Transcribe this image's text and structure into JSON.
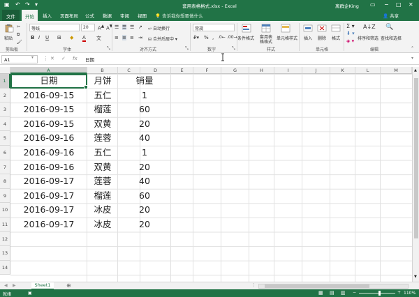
{
  "window": {
    "title": "套用表格格式.xlsx - Excel",
    "user": "离群企King",
    "share": "共享"
  },
  "tabs": [
    "文件",
    "开始",
    "插入",
    "页面布局",
    "公式",
    "数据",
    "审阅",
    "视图"
  ],
  "active_tab": "开始",
  "tell_me": "告诉我你想要做什么",
  "ribbon": {
    "paste": "粘贴",
    "font_name": "等线",
    "font_size": "20",
    "wrap_text": "自动换行",
    "merge_center": "合并后居中",
    "number_format": "常规",
    "cond_format": "条件格式",
    "table_format": "套用表格格式",
    "cell_styles": "单元格样式",
    "insert": "插入",
    "delete": "删除",
    "format": "格式",
    "sort_filter": "排序和筛选",
    "find_select": "查找和选择",
    "groups": [
      "剪贴板",
      "字体",
      "对齐方式",
      "数字",
      "样式",
      "单元格",
      "编辑"
    ]
  },
  "formula_bar": {
    "name_box": "A1",
    "fx": "fx",
    "content": "日期"
  },
  "columns": [
    "A",
    "B",
    "C",
    "D",
    "E",
    "F",
    "G",
    "H",
    "I",
    "J",
    "K",
    "L",
    "M"
  ],
  "rows": [
    "1",
    "2",
    "3",
    "4",
    "5",
    "6",
    "7",
    "8",
    "9",
    "10",
    "11",
    "12",
    "13",
    "14"
  ],
  "table": {
    "headers": [
      "日期",
      "月饼",
      "销量"
    ],
    "rows": [
      [
        "2016-09-15",
        "五仁",
        "1"
      ],
      [
        "2016-09-15",
        "榴莲",
        "60"
      ],
      [
        "2016-09-15",
        "双黄",
        "20"
      ],
      [
        "2016-09-16",
        "莲蓉",
        "40"
      ],
      [
        "2016-09-16",
        "五仁",
        "1"
      ],
      [
        "2016-09-16",
        "双黄",
        "20"
      ],
      [
        "2016-09-17",
        "莲蓉",
        "40"
      ],
      [
        "2016-09-17",
        "榴莲",
        "60"
      ],
      [
        "2016-09-17",
        "冰皮",
        "20"
      ],
      [
        "2016-09-17",
        "冰皮",
        "20"
      ]
    ]
  },
  "sheet": {
    "name": "Sheet1"
  },
  "status": {
    "ready": "就绪",
    "zoom": "110%"
  },
  "colors": {
    "accent": "#217346"
  }
}
